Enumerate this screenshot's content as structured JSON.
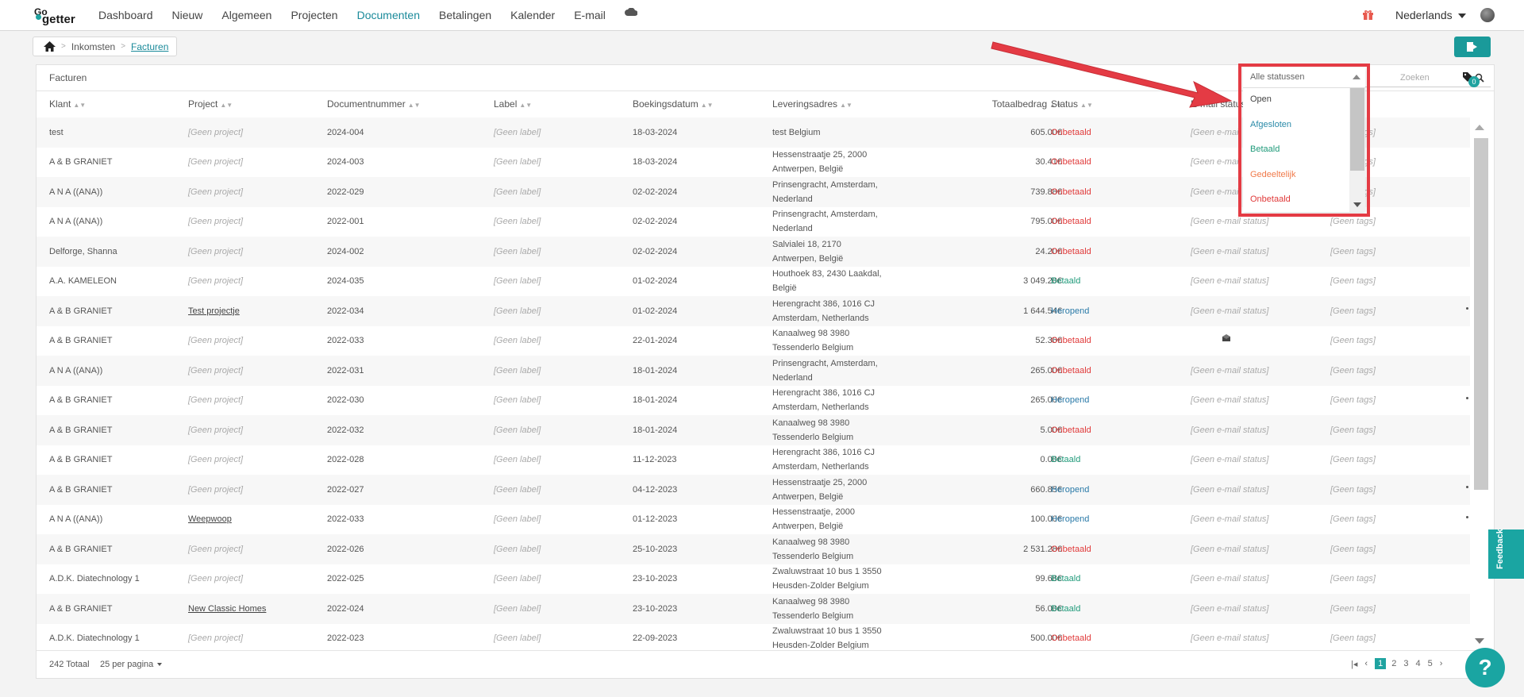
{
  "topbar": {
    "logo_top": "Go",
    "logo_bottom": "getter",
    "nav": [
      {
        "label": "Dashboard"
      },
      {
        "label": "Nieuw"
      },
      {
        "label": "Algemeen"
      },
      {
        "label": "Projecten"
      },
      {
        "label": "Documenten"
      },
      {
        "label": "Betalingen"
      },
      {
        "label": "Kalender"
      },
      {
        "label": "E-mail"
      }
    ],
    "language": "Nederlands"
  },
  "breadcrumb": {
    "level1": "Inkomsten",
    "level2": "Facturen"
  },
  "panel": {
    "title": "Facturen",
    "search_placeholder": "Zoeken",
    "tags_count": "0"
  },
  "columns": {
    "klant": "Klant",
    "project": "Project",
    "documentnummer": "Documentnummer",
    "label": "Label",
    "boekingsdatum": "Boekingsdatum",
    "leveringsadres": "Leveringsadres",
    "totaalbedrag": "Totaalbedrag",
    "status": "Status",
    "email_status": "E-mail status"
  },
  "placeholders": {
    "project": "[Geen project]",
    "label": "[Geen label]",
    "email_status": "[Geen e-mail status]",
    "tags": "[Geen tags]"
  },
  "rows": [
    {
      "klant": "test",
      "project": "",
      "doc": "2024-004",
      "datum": "18-03-2024",
      "adres1": "test Belgium",
      "adres2": "",
      "bedrag": "605.00€",
      "status": "Onbetaald",
      "dot": false,
      "mail": false
    },
    {
      "klant": "A & B GRANIET",
      "project": "",
      "doc": "2024-003",
      "datum": "18-03-2024",
      "adres1": "Hessenstraatje 25, 2000",
      "adres2": "Antwerpen, België",
      "bedrag": "30.41€",
      "status": "Onbetaald",
      "dot": false,
      "mail": false
    },
    {
      "klant": "A N A ((ANA))",
      "project": "",
      "doc": "2022-029",
      "datum": "02-02-2024",
      "adres1": "Prinsengracht, Amsterdam,",
      "adres2": "Nederland",
      "bedrag": "739.88€",
      "status": "Onbetaald",
      "dot": false,
      "mail": false
    },
    {
      "klant": "A N A ((ANA))",
      "project": "",
      "doc": "2022-001",
      "datum": "02-02-2024",
      "adres1": "Prinsengracht, Amsterdam,",
      "adres2": "Nederland",
      "bedrag": "795.00€",
      "status": "Onbetaald",
      "dot": false,
      "mail": false
    },
    {
      "klant": "Delforge, Shanna",
      "project": "",
      "doc": "2024-002",
      "datum": "02-02-2024",
      "adres1": "Salvialei 18, 2170",
      "adres2": "Antwerpen, België",
      "bedrag": "24.20€",
      "status": "Onbetaald",
      "dot": false,
      "mail": false
    },
    {
      "klant": "A.A. KAMELEON",
      "project": "",
      "doc": "2024-035",
      "datum": "01-02-2024",
      "adres1": "Houthoek 83, 2430 Laakdal,",
      "adres2": "België",
      "bedrag": "3 049.20€",
      "status": "Betaald",
      "dot": false,
      "mail": false
    },
    {
      "klant": "A & B GRANIET",
      "project": "Test projectje",
      "doc": "2022-034",
      "datum": "01-02-2024",
      "adres1": "Herengracht 386, 1016 CJ",
      "adres2": "Amsterdam, Netherlands",
      "bedrag": "1 644.54€",
      "status": "Heropend",
      "dot": true,
      "mail": false
    },
    {
      "klant": "A & B GRANIET",
      "project": "",
      "doc": "2022-033",
      "datum": "22-01-2024",
      "adres1": "Kanaalweg 98 3980",
      "adres2": "Tessenderlo Belgium",
      "bedrag": "52.36€",
      "status": "Onbetaald",
      "dot": false,
      "mail": true
    },
    {
      "klant": "A N A ((ANA))",
      "project": "",
      "doc": "2022-031",
      "datum": "18-01-2024",
      "adres1": "Prinsengracht, Amsterdam,",
      "adres2": "Nederland",
      "bedrag": "265.00€",
      "status": "Onbetaald",
      "dot": false,
      "mail": false
    },
    {
      "klant": "A & B GRANIET",
      "project": "",
      "doc": "2022-030",
      "datum": "18-01-2024",
      "adres1": "Herengracht 386, 1016 CJ",
      "adres2": "Amsterdam, Netherlands",
      "bedrag": "265.00€",
      "status": "Heropend",
      "dot": true,
      "mail": false
    },
    {
      "klant": "A & B GRANIET",
      "project": "",
      "doc": "2022-032",
      "datum": "18-01-2024",
      "adres1": "Kanaalweg 98 3980",
      "adres2": "Tessenderlo Belgium",
      "bedrag": "5.00€",
      "status": "Onbetaald",
      "dot": false,
      "mail": false
    },
    {
      "klant": "A & B GRANIET",
      "project": "",
      "doc": "2022-028",
      "datum": "11-12-2023",
      "adres1": "Herengracht 386, 1016 CJ",
      "adres2": "Amsterdam, Netherlands",
      "bedrag": "0.00€",
      "status": "Betaald",
      "dot": false,
      "mail": false
    },
    {
      "klant": "A & B GRANIET",
      "project": "",
      "doc": "2022-027",
      "datum": "04-12-2023",
      "adres1": "Hessenstraatje 25, 2000",
      "adres2": "Antwerpen, België",
      "bedrag": "660.85€",
      "status": "Heropend",
      "dot": true,
      "mail": false
    },
    {
      "klant": "A N A ((ANA))",
      "project": "Weepwoop",
      "doc": "2022-033",
      "datum": "01-12-2023",
      "adres1": "Hessenstraatje, 2000",
      "adres2": "Antwerpen, België",
      "bedrag": "100.00€",
      "status": "Heropend",
      "dot": true,
      "mail": false
    },
    {
      "klant": "A & B GRANIET",
      "project": "",
      "doc": "2022-026",
      "datum": "25-10-2023",
      "adres1": "Kanaalweg 98 3980",
      "adres2": "Tessenderlo Belgium",
      "bedrag": "2 531.28€",
      "status": "Onbetaald",
      "dot": false,
      "mail": false
    },
    {
      "klant": "A.D.K. Diatechnology 1",
      "project": "",
      "doc": "2022-025",
      "datum": "23-10-2023",
      "adres1": "Zwaluwstraat 10 bus 1 3550",
      "adres2": "Heusden-Zolder Belgium",
      "bedrag": "99.68€",
      "status": "Betaald",
      "dot": false,
      "mail": false
    },
    {
      "klant": "A & B GRANIET",
      "project": "New Classic Homes",
      "doc": "2022-024",
      "datum": "23-10-2023",
      "adres1": "Kanaalweg 98 3980",
      "adres2": "Tessenderlo Belgium",
      "bedrag": "56.00€",
      "status": "Betaald",
      "dot": false,
      "mail": false
    },
    {
      "klant": "A.D.K. Diatechnology 1",
      "project": "",
      "doc": "2022-023",
      "datum": "22-09-2023",
      "adres1": "Zwaluwstraat 10 bus 1 3550",
      "adres2": "Heusden-Zolder Belgium",
      "bedrag": "500.00€",
      "status": "Onbetaald",
      "dot": false,
      "mail": false
    }
  ],
  "footer": {
    "total": "242 Totaal",
    "per_page": "25 per pagina",
    "pages": [
      "1",
      "2",
      "3",
      "4",
      "5"
    ],
    "active_page": "1"
  },
  "status_dropdown": {
    "placeholder": "Alle statussen",
    "options": [
      {
        "label": "Open",
        "color": "#444444"
      },
      {
        "label": "Afgesloten",
        "color": "#2a8aa8"
      },
      {
        "label": "Betaald",
        "color": "#1f9a7a"
      },
      {
        "label": "Gedeeltelijk",
        "color": "#f07a4a"
      },
      {
        "label": "Onbetaald",
        "color": "#e03a3a"
      }
    ]
  },
  "feedback_label": "Feedback",
  "help_label": "?",
  "colors": {
    "accent": "#1fa3a0",
    "onbetaald": "#e03a3a",
    "betaald": "#1f9a7a",
    "heropend": "#2a7aa8",
    "annotation_red": "#e43b44"
  }
}
